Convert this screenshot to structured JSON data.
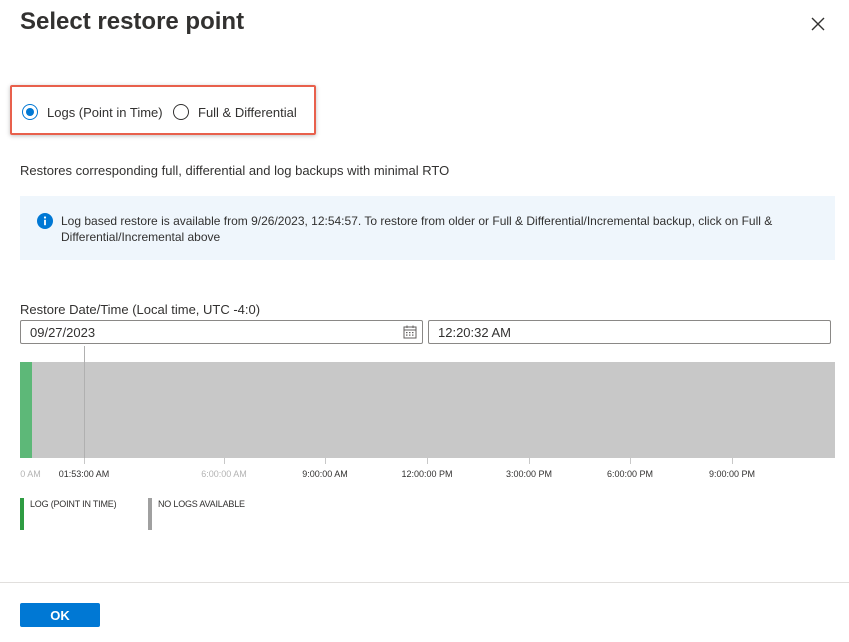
{
  "dialog": {
    "title": "Select restore point"
  },
  "restore_type": {
    "options": [
      {
        "label": "Logs (Point in Time)",
        "selected": true
      },
      {
        "label": "Full & Differential",
        "selected": false
      }
    ]
  },
  "description": "Restores corresponding full, differential and log backups with minimal RTO",
  "info_banner": {
    "icon": "info-icon",
    "text": "Log based restore is available from 9/26/2023, 12:54:57. To restore from older or Full & Differential/Incremental backup, click on Full & Differential/Incremental above"
  },
  "restore_datetime": {
    "label": "Restore Date/Time (Local time, UTC -4:0)",
    "date_value": "09/27/2023",
    "time_value": "12:20:32 AM"
  },
  "timeline": {
    "tick_labels": [
      "00 AM",
      "01:53:00 AM",
      "6:00:00 AM",
      "9:00:00 AM",
      "12:00:00 PM",
      "3:00:00 PM",
      "6:00:00 PM",
      "9:00:00 PM"
    ],
    "legend": [
      {
        "label": "LOG (POINT IN TIME)",
        "color": "#2e9c42"
      },
      {
        "label": "NO LOGS AVAILABLE",
        "color": "#a0a0a0"
      }
    ]
  },
  "footer": {
    "ok_label": "OK"
  },
  "colors": {
    "accent": "#0078d4",
    "log_available": "#5db878",
    "no_logs": "#c8c8c8",
    "highlight_border": "#e8604c"
  }
}
